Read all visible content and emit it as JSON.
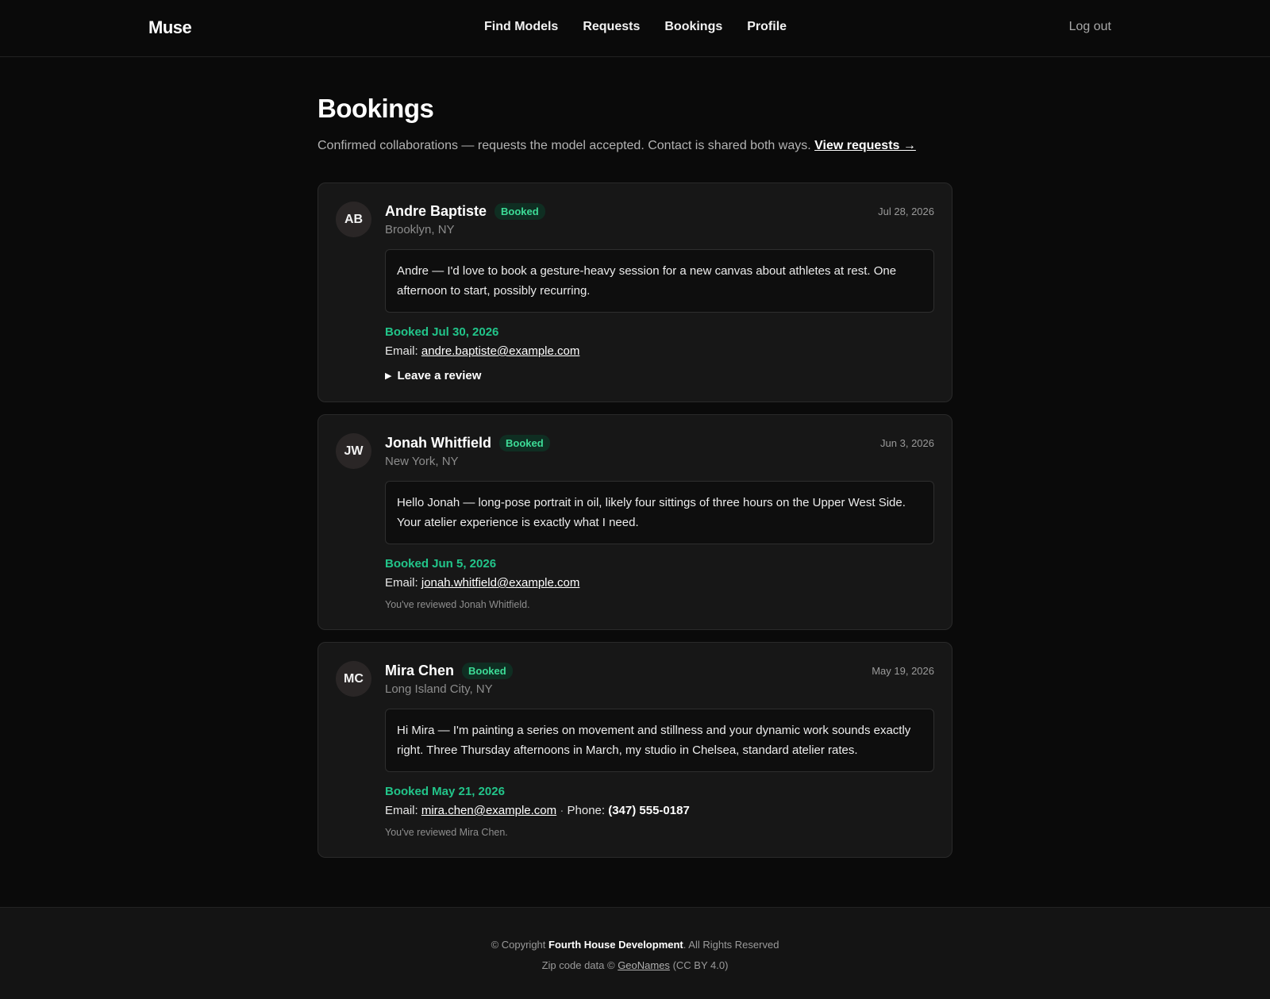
{
  "nav": {
    "brand": "Muse",
    "links": [
      "Find Models",
      "Requests",
      "Bookings",
      "Profile"
    ],
    "logout": "Log out"
  },
  "page": {
    "title": "Bookings",
    "subtitle": "Confirmed collaborations — requests the model accepted. Contact is shared both ways.",
    "view_requests": "View requests →"
  },
  "bookings": [
    {
      "initials": "AB",
      "name": "Andre Baptiste",
      "badge": "Booked",
      "date": "Jul 28, 2026",
      "location": "Brooklyn, NY",
      "message": "Andre — I'd love to book a gesture-heavy session for a new canvas about athletes at rest. One afternoon to start, possibly recurring.",
      "booked_line": "Booked Jul 30, 2026",
      "email_label": "Email:",
      "email": "andre.baptiste@example.com",
      "review_action": "Leave a review"
    },
    {
      "initials": "JW",
      "name": "Jonah Whitfield",
      "badge": "Booked",
      "date": "Jun 3, 2026",
      "location": "New York, NY",
      "message": "Hello Jonah — long-pose portrait in oil, likely four sittings of three hours on the Upper West Side. Your atelier experience is exactly what I need.",
      "booked_line": "Booked Jun 5, 2026",
      "email_label": "Email:",
      "email": "jonah.whitfield@example.com",
      "reviewed_note": "You've reviewed Jonah Whitfield."
    },
    {
      "initials": "MC",
      "name": "Mira Chen",
      "badge": "Booked",
      "date": "May 19, 2026",
      "location": "Long Island City, NY",
      "message": "Hi Mira — I'm painting a series on movement and stillness and your dynamic work sounds exactly right. Three Thursday afternoons in March, my studio in Chelsea, standard atelier rates.",
      "booked_line": "Booked May 21, 2026",
      "email_label": "Email:",
      "email": "mira.chen@example.com",
      "phone_sep": "·",
      "phone_label": "Phone:",
      "phone": "(347) 555-0187",
      "reviewed_note": "You've reviewed Mira Chen."
    }
  ],
  "footer": {
    "copyright_prefix": "© Copyright",
    "company": "Fourth House Development",
    "rights": ". All Rights Reserved",
    "zip_prefix": "Zip code data ©",
    "geonames": "GeoNames",
    "license": "(CC BY 4.0)"
  },
  "colors": {
    "accent_green": "#22c58a",
    "badge_text": "#3ddc97",
    "background": "#0a0a0a",
    "card": "#171717"
  }
}
